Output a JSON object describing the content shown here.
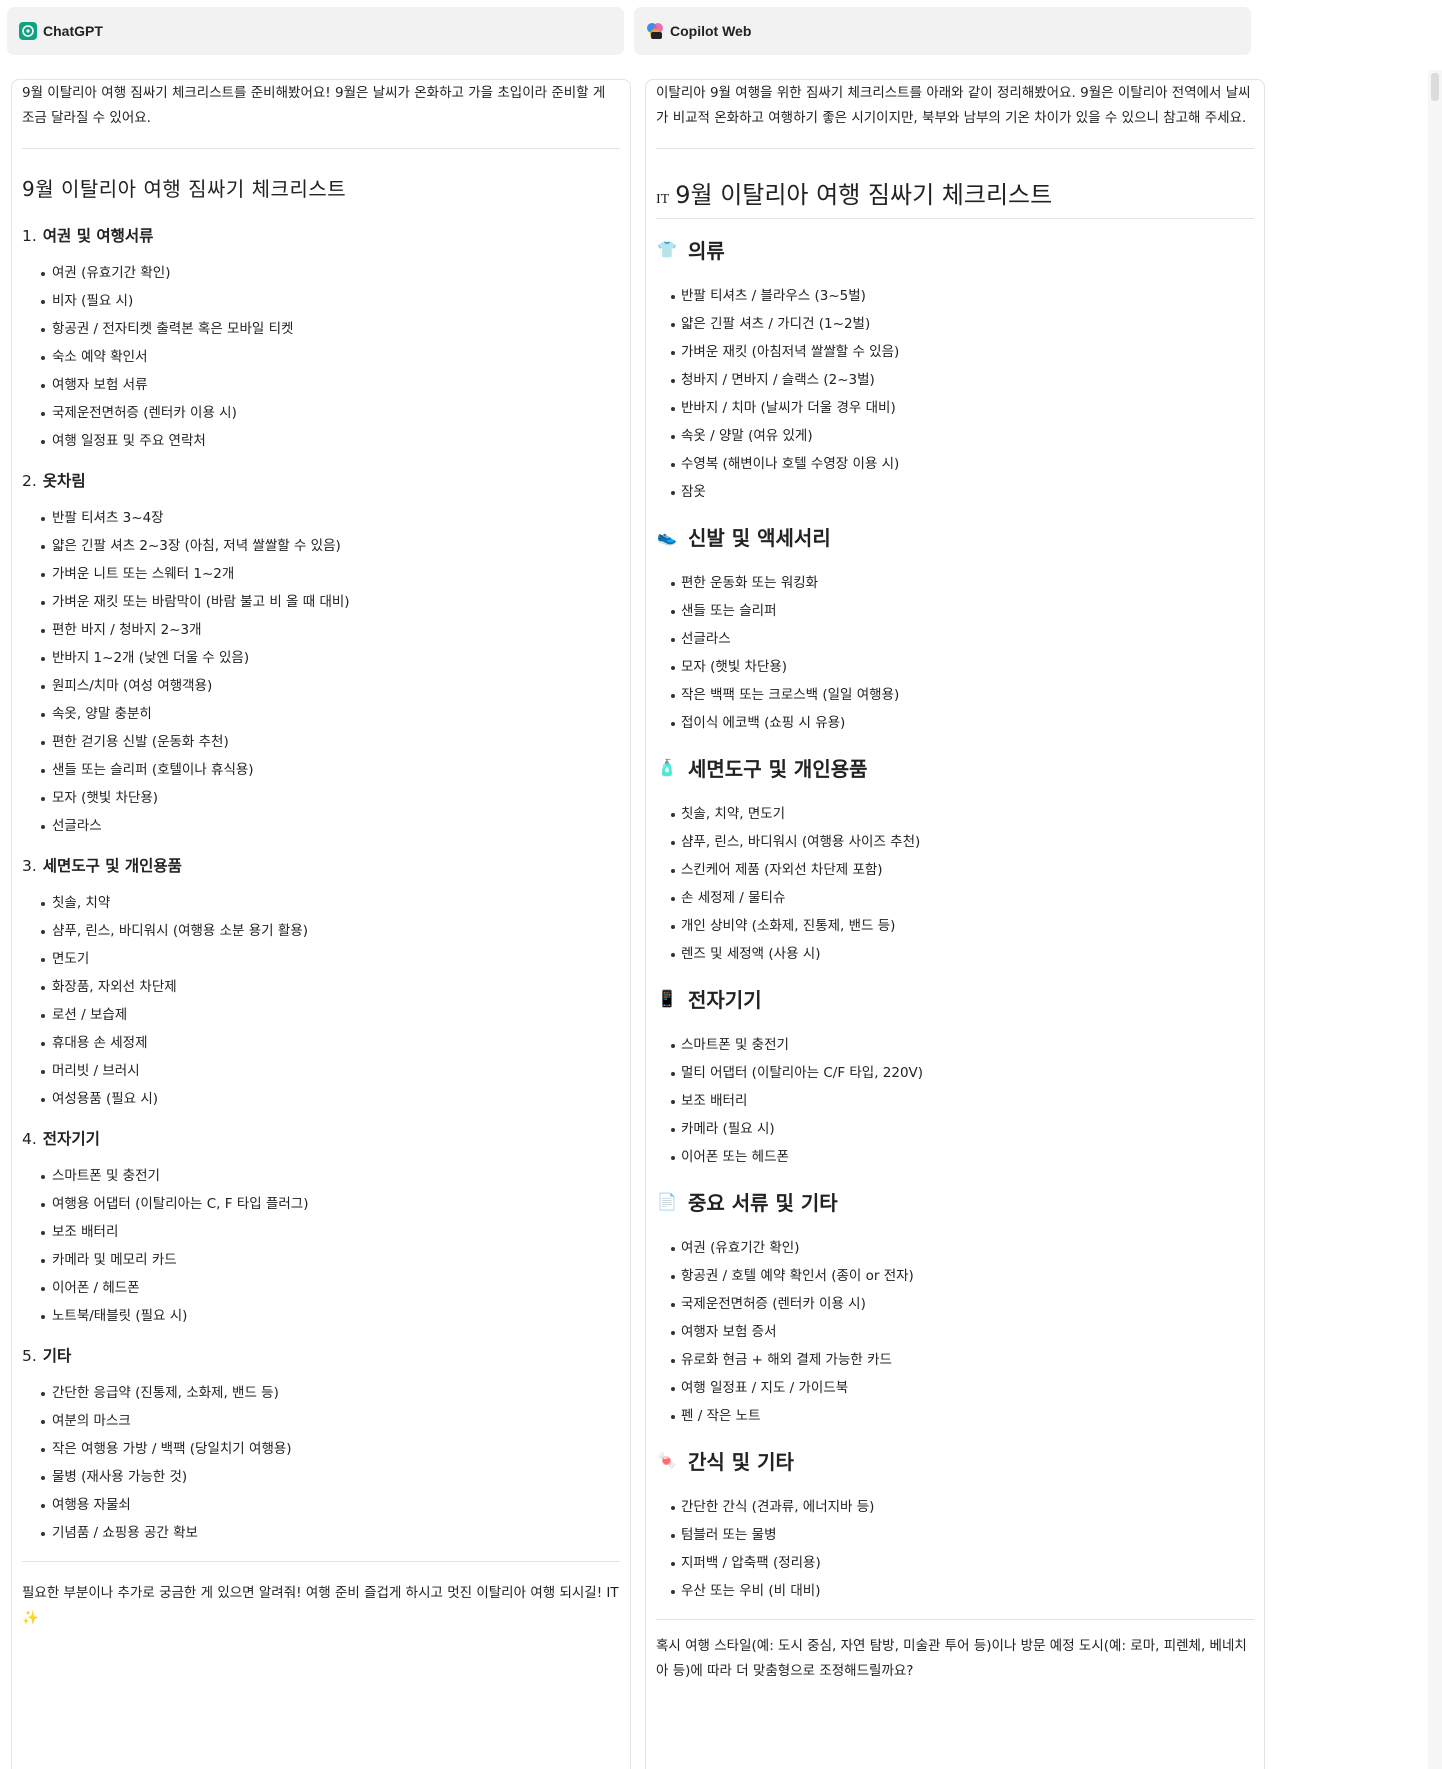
{
  "tabs": [
    {
      "label": "ChatGPT"
    },
    {
      "label": "Copilot Web"
    }
  ],
  "left": {
    "intro": "9월 이탈리아 여행 짐싸기 체크리스트를 준비해봤어요! 9월은 날씨가 온화하고 가을 초입이라 준비할 게 조금 달라질 수 있어요.",
    "title": "9월 이탈리아 여행 짐싸기 체크리스트",
    "sections": [
      {
        "num": "1.",
        "title": "여권 및 여행서류",
        "items": [
          "여권 (유효기간 확인)",
          "비자 (필요 시)",
          "항공권 / 전자티켓 출력본 혹은 모바일 티켓",
          "숙소 예약 확인서",
          "여행자 보험 서류",
          "국제운전면허증 (렌터카 이용 시)",
          "여행 일정표 및 주요 연락처"
        ]
      },
      {
        "num": "2.",
        "title": "옷차림",
        "items": [
          "반팔 티셔츠 3~4장",
          "얇은 긴팔 셔츠 2~3장 (아침, 저녁 쌀쌀할 수 있음)",
          "가벼운 니트 또는 스웨터 1~2개",
          "가벼운 재킷 또는 바람막이 (바람 불고 비 올 때 대비)",
          "편한 바지 / 청바지 2~3개",
          "반바지 1~2개 (낮엔 더울 수 있음)",
          "원피스/치마 (여성 여행객용)",
          "속옷, 양말 충분히",
          "편한 걷기용 신발 (운동화 추천)",
          "샌들 또는 슬리퍼 (호텔이나 휴식용)",
          "모자 (햇빛 차단용)",
          "선글라스"
        ]
      },
      {
        "num": "3.",
        "title": "세면도구 및 개인용품",
        "items": [
          "칫솔, 치약",
          "샴푸, 린스, 바디워시 (여행용 소분 용기 활용)",
          "면도기",
          "화장품, 자외선 차단제",
          "로션 / 보습제",
          "휴대용 손 세정제",
          "머리빗 / 브러시",
          "여성용품 (필요 시)"
        ]
      },
      {
        "num": "4.",
        "title": "전자기기",
        "items": [
          "스마트폰 및 충전기",
          "여행용 어댑터 (이탈리아는 C, F 타입 플러그)",
          "보조 배터리",
          "카메라 및 메모리 카드",
          "이어폰 / 헤드폰",
          "노트북/태블릿 (필요 시)"
        ]
      },
      {
        "num": "5.",
        "title": "기타",
        "items": [
          "간단한 응급약 (진통제, 소화제, 밴드 등)",
          "여분의 마스크",
          "작은 여행용 가방 / 백팩 (당일치기 여행용)",
          "물병 (재사용 가능한 것)",
          "여행용 자물쇠",
          "기념품 / 쇼핑용 공간 확보"
        ]
      }
    ],
    "closing": "필요한 부분이나 추가로 궁금한 게 있으면 알려줘! 여행 준비 즐겁게 하시고 멋진 이탈리아 여행 되시길! IT ✨"
  },
  "right": {
    "intro": "이탈리아 9월 여행을 위한 짐싸기 체크리스트를 아래와 같이 정리해봤어요. 9월은 이탈리아 전역에서 날씨가 비교적 온화하고 여행하기 좋은 시기이지만, 북부와 남부의 기온 차이가 있을 수 있으니 참고해 주세요.",
    "title_prefix": "IT",
    "title": "9월 이탈리아 여행 짐싸기 체크리스트",
    "sections": [
      {
        "icon": "👕",
        "icon_name": "tshirt-icon",
        "title": "의류",
        "items": [
          "반팔 티셔츠 / 블라우스 (3~5벌)",
          "얇은 긴팔 셔츠 / 가디건 (1~2벌)",
          "가벼운 재킷 (아침저녁 쌀쌀할 수 있음)",
          "청바지 / 면바지 / 슬랙스 (2~3벌)",
          "반바지 / 치마 (날씨가 더울 경우 대비)",
          "속옷 / 양말 (여유 있게)",
          "수영복 (해변이나 호텔 수영장 이용 시)",
          "잠옷"
        ]
      },
      {
        "icon": "👟",
        "icon_name": "sneaker-icon",
        "title": "신발 및 액세서리",
        "items": [
          "편한 운동화 또는 워킹화",
          "샌들 또는 슬리퍼",
          "선글라스",
          "모자 (햇빛 차단용)",
          "작은 백팩 또는 크로스백 (일일 여행용)",
          "접이식 에코백 (쇼핑 시 유용)"
        ]
      },
      {
        "icon": "🧴",
        "icon_name": "lotion-bottle-icon",
        "title": "세면도구 및 개인용품",
        "items": [
          "칫솔, 치약, 면도기",
          "샴푸, 린스, 바디워시 (여행용 사이즈 추천)",
          "스킨케어 제품 (자외선 차단제 포함)",
          "손 세정제 / 물티슈",
          "개인 상비약 (소화제, 진통제, 밴드 등)",
          "렌즈 및 세정액 (사용 시)"
        ]
      },
      {
        "icon": "📱",
        "icon_name": "smartphone-icon",
        "title": "전자기기",
        "items": [
          "스마트폰 및 충전기",
          "멀티 어댑터 (이탈리아는 C/F 타입, 220V)",
          "보조 배터리",
          "카메라 (필요 시)",
          "이어폰 또는 헤드폰"
        ]
      },
      {
        "icon": "📄",
        "icon_name": "document-icon",
        "title": "중요 서류 및 기타",
        "items": [
          "여권 (유효기간 확인)",
          "항공권 / 호텔 예약 확인서 (종이 or 전자)",
          "국제운전면허증 (렌터카 이용 시)",
          "여행자 보험 증서",
          "유로화 현금 + 해외 결제 가능한 카드",
          "여행 일정표 / 지도 / 가이드북",
          "펜 / 작은 노트"
        ]
      },
      {
        "icon": "🍬",
        "icon_name": "candy-icon",
        "title": "간식 및 기타",
        "items": [
          "간단한 간식 (견과류, 에너지바 등)",
          "텀블러 또는 물병",
          "지퍼백 / 압축팩 (정리용)",
          "우산 또는 우비 (비 대비)"
        ]
      }
    ],
    "closing": "혹시 여행 스타일(예: 도시 중심, 자연 탐방, 미술관 투어 등)이나 방문 예정 도시(예: 로마, 피렌체, 베네치아 등)에 따라 더 맞춤형으로 조정해드릴까요?"
  }
}
